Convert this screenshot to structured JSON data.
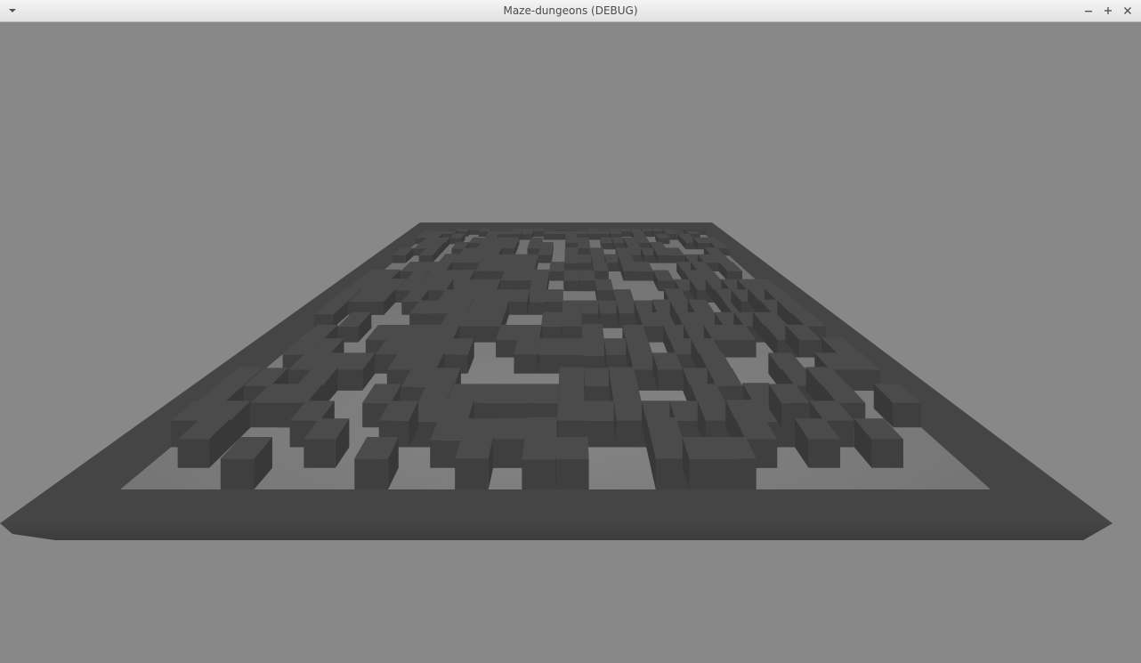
{
  "window": {
    "title": "Maze-dungeons (DEBUG)",
    "controls": [
      "minimize",
      "maximize",
      "close"
    ]
  },
  "scene": {
    "background_color": "#888888",
    "floor_color": "#7f7f7f",
    "wall_color": "#474747",
    "wall_top_color": "#4a4a4a",
    "wall_side_color": "#3d3d3d",
    "frame_color": "#434343"
  }
}
